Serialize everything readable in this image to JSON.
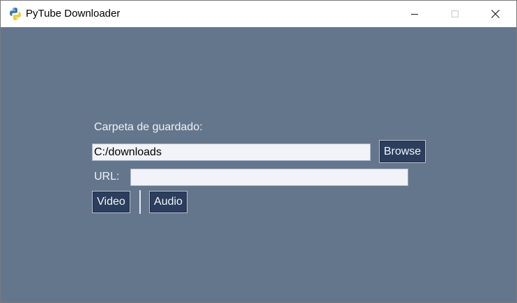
{
  "window": {
    "title": "PyTube Downloader",
    "icon": "python-icon",
    "controls": [
      "minimize-icon",
      "maximize-icon",
      "close-icon"
    ]
  },
  "form": {
    "folder_label": "Carpeta de guardado:",
    "folder_value": "C:/downloads",
    "browse_label": "Browse",
    "url_label": "URL:",
    "url_value": "",
    "video_label": "Video",
    "audio_label": "Audio"
  },
  "colors": {
    "background": "#64768b",
    "button": "#2b3e5d",
    "entry": "#f1f3f8"
  }
}
